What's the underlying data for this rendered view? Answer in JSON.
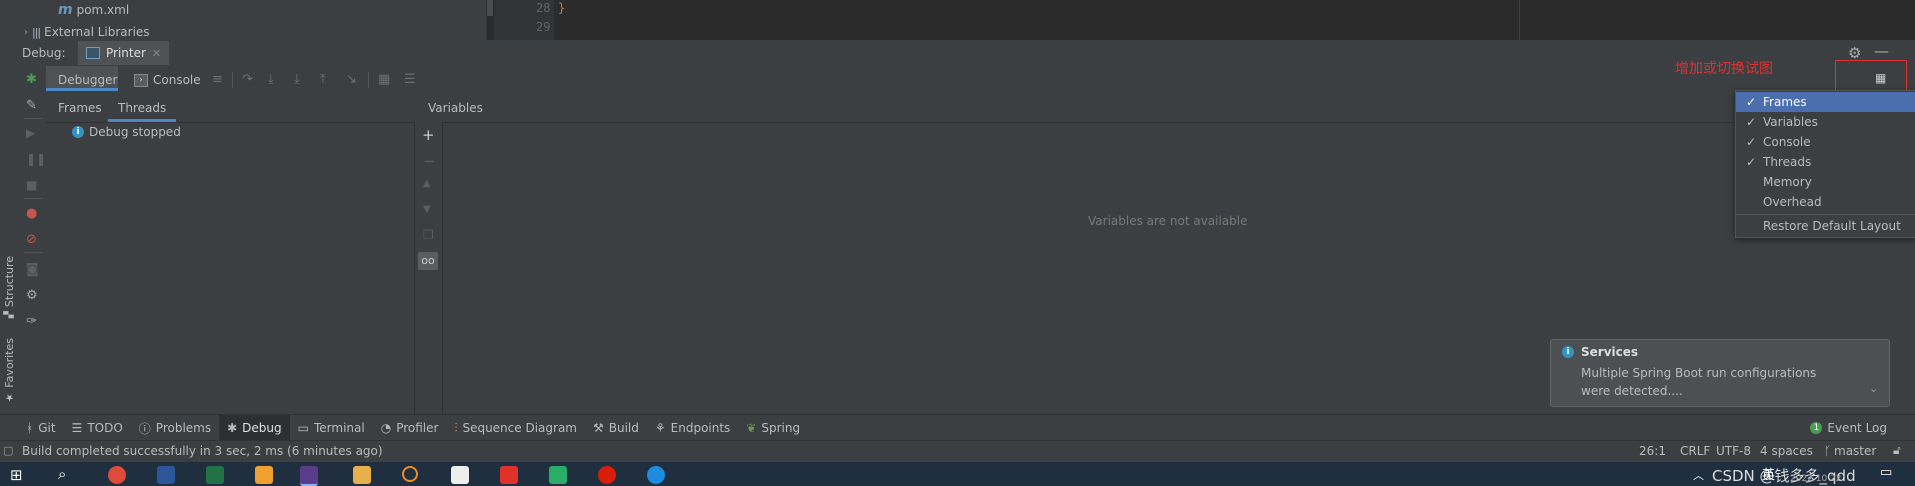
{
  "project": {
    "rows": [
      {
        "icon": "maven-m-icon",
        "label": "pom.xml"
      },
      {
        "icon": "library-icon",
        "label": "External Libraries"
      }
    ]
  },
  "editor": {
    "line_numbers": [
      "28",
      "29"
    ],
    "code_line": "}"
  },
  "debug": {
    "title": "Debug:",
    "run_config": "Printer",
    "tabs": {
      "debugger": "Debugger",
      "console": "Console"
    },
    "frames_tabs": {
      "frames": "Frames",
      "threads": "Threads"
    },
    "thread_status": "Debug stopped",
    "variables_header": "Variables",
    "variables_empty": "Variables are not available"
  },
  "side_labels": {
    "structure": "Structure",
    "favorites": "Favorites"
  },
  "annotation": "增加或切换试图",
  "layout_menu": {
    "items": [
      {
        "label": "Frames",
        "checked": "✓",
        "selected": true
      },
      {
        "label": "Variables",
        "checked": "✓"
      },
      {
        "label": "Console",
        "checked": "✓"
      },
      {
        "label": "Threads",
        "checked": "✓"
      },
      {
        "label": "Memory",
        "checked": ""
      },
      {
        "label": "Overhead",
        "checked": ""
      }
    ],
    "restore": "Restore Default Layout"
  },
  "notification": {
    "title": "Services",
    "body1": "Multiple Spring Boot run configurations",
    "body2": "were detected...."
  },
  "tool_windows": [
    {
      "icon": "git-icon",
      "label": "Git"
    },
    {
      "icon": "todo-icon",
      "label": "TODO"
    },
    {
      "icon": "problems-icon",
      "label": "Problems"
    },
    {
      "icon": "debug-icon",
      "label": "Debug",
      "active": true
    },
    {
      "icon": "terminal-icon",
      "label": "Terminal"
    },
    {
      "icon": "profiler-icon",
      "label": "Profiler"
    },
    {
      "icon": "sequence-diagram-icon",
      "label": "Sequence Diagram"
    },
    {
      "icon": "build-icon",
      "label": "Build"
    },
    {
      "icon": "endpoints-icon",
      "label": "Endpoints"
    },
    {
      "icon": "spring-icon",
      "label": "Spring"
    }
  ],
  "event_log": "Event Log",
  "status": {
    "message": "Build completed successfully in 3 sec, 2 ms (6 minutes ago)",
    "position": "26:1",
    "line_sep": "CRLF",
    "encoding": "UTF-8",
    "indent": "4 spaces",
    "branch": "master"
  },
  "taskbar": {
    "watermark": "CSDN @钱多多_qdd",
    "ime": "英",
    "clock_partial": "2022 10 22"
  },
  "colors": {
    "accent": "#4a88c7",
    "selection": "#4b6eaf",
    "annotation": "#e03030",
    "panel": "#3c3f41"
  }
}
